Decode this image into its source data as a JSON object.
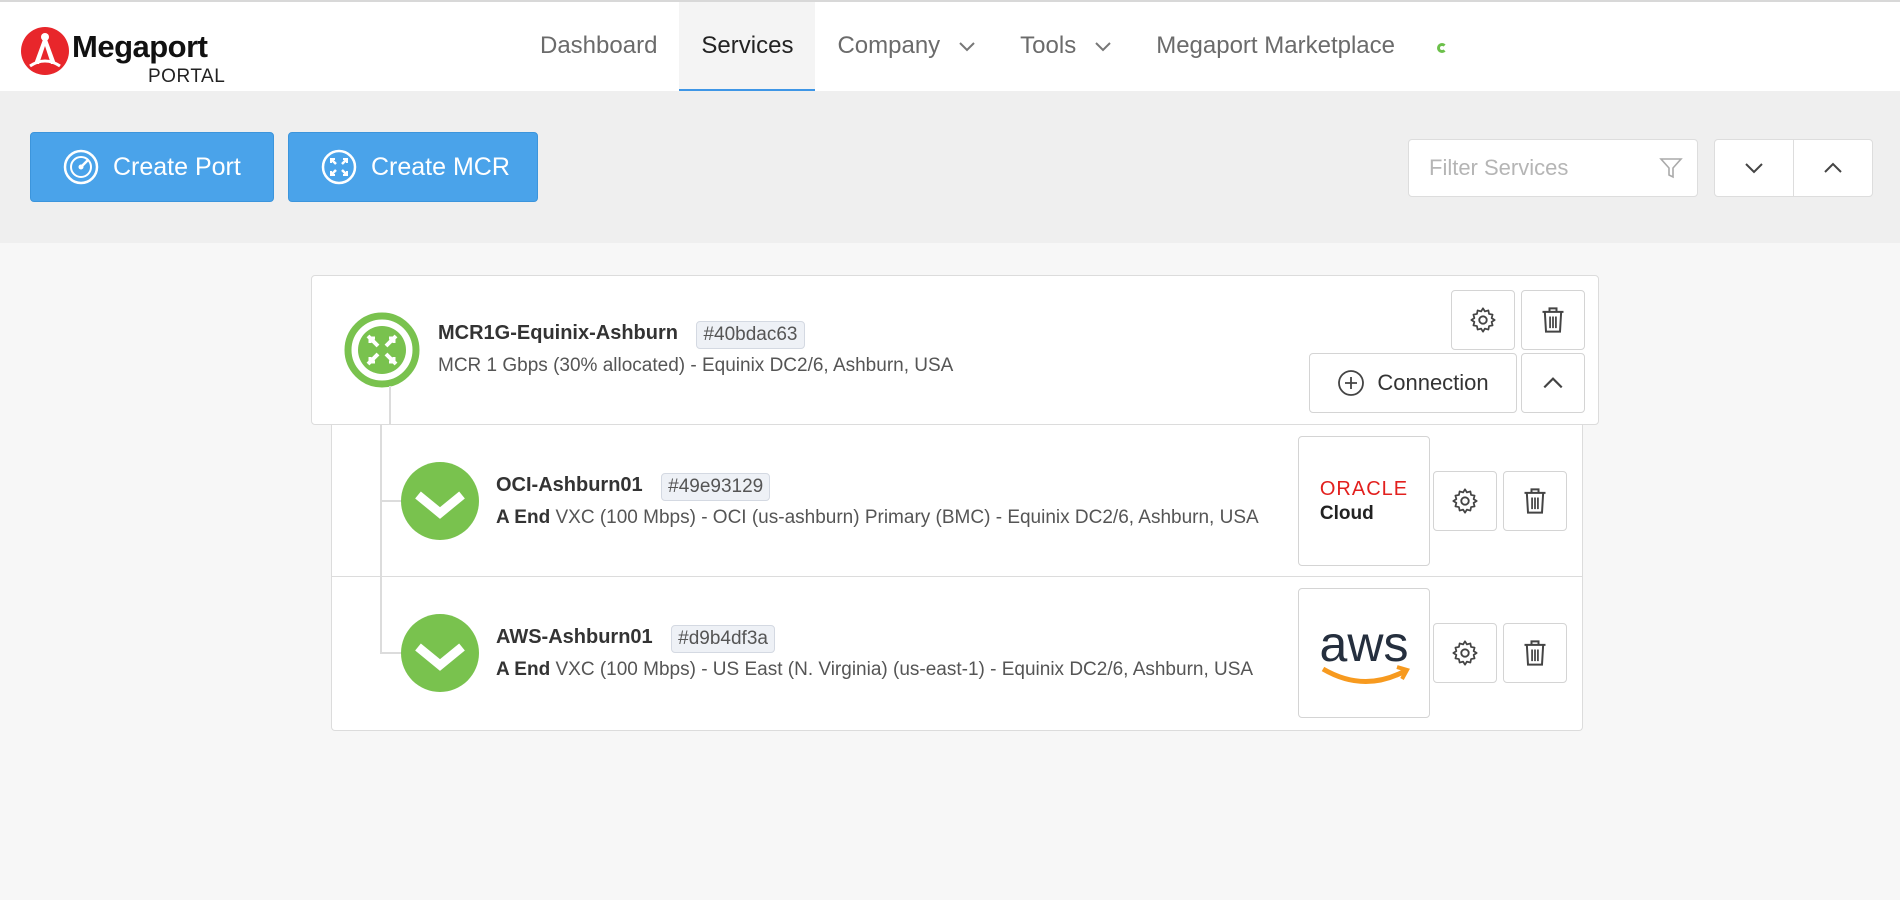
{
  "brand": {
    "name": "Megaport",
    "sub": "PORTAL",
    "color": "#e8262b"
  },
  "nav": {
    "items": [
      {
        "label": "Dashboard"
      },
      {
        "label": "Services"
      },
      {
        "label": "Company"
      },
      {
        "label": "Tools"
      },
      {
        "label": "Megaport Marketplace"
      }
    ],
    "active": "Services"
  },
  "toolbar": {
    "create_port_label": "Create Port",
    "create_mcr_label": "Create MCR",
    "filter_placeholder": "Filter Services",
    "accent": "#4aa3ea"
  },
  "mcr": {
    "name": "MCR1G-Equinix-Ashburn",
    "id": "#40bdac63",
    "description": "MCR 1 Gbps (30% allocated) - Equinix DC2/6, Ashburn, USA",
    "connection_label": "Connection",
    "status_color": "#79c24e"
  },
  "vxcs": [
    {
      "name": "OCI-Ashburn01",
      "id": "#49e93129",
      "end_label": "A End",
      "description": "VXC (100 Mbps) - OCI (us-ashburn) Primary (BMC) - Equinix DC2/6, Ashburn, USA",
      "provider_word": "ORACLE",
      "provider_sub": "Cloud"
    },
    {
      "name": "AWS-Ashburn01",
      "id": "#d9b4df3a",
      "end_label": "A End",
      "description": "VXC (100 Mbps) - US East (N. Virginia) (us-east-1) - Equinix DC2/6, Ashburn, USA",
      "provider_word": "aws"
    }
  ]
}
